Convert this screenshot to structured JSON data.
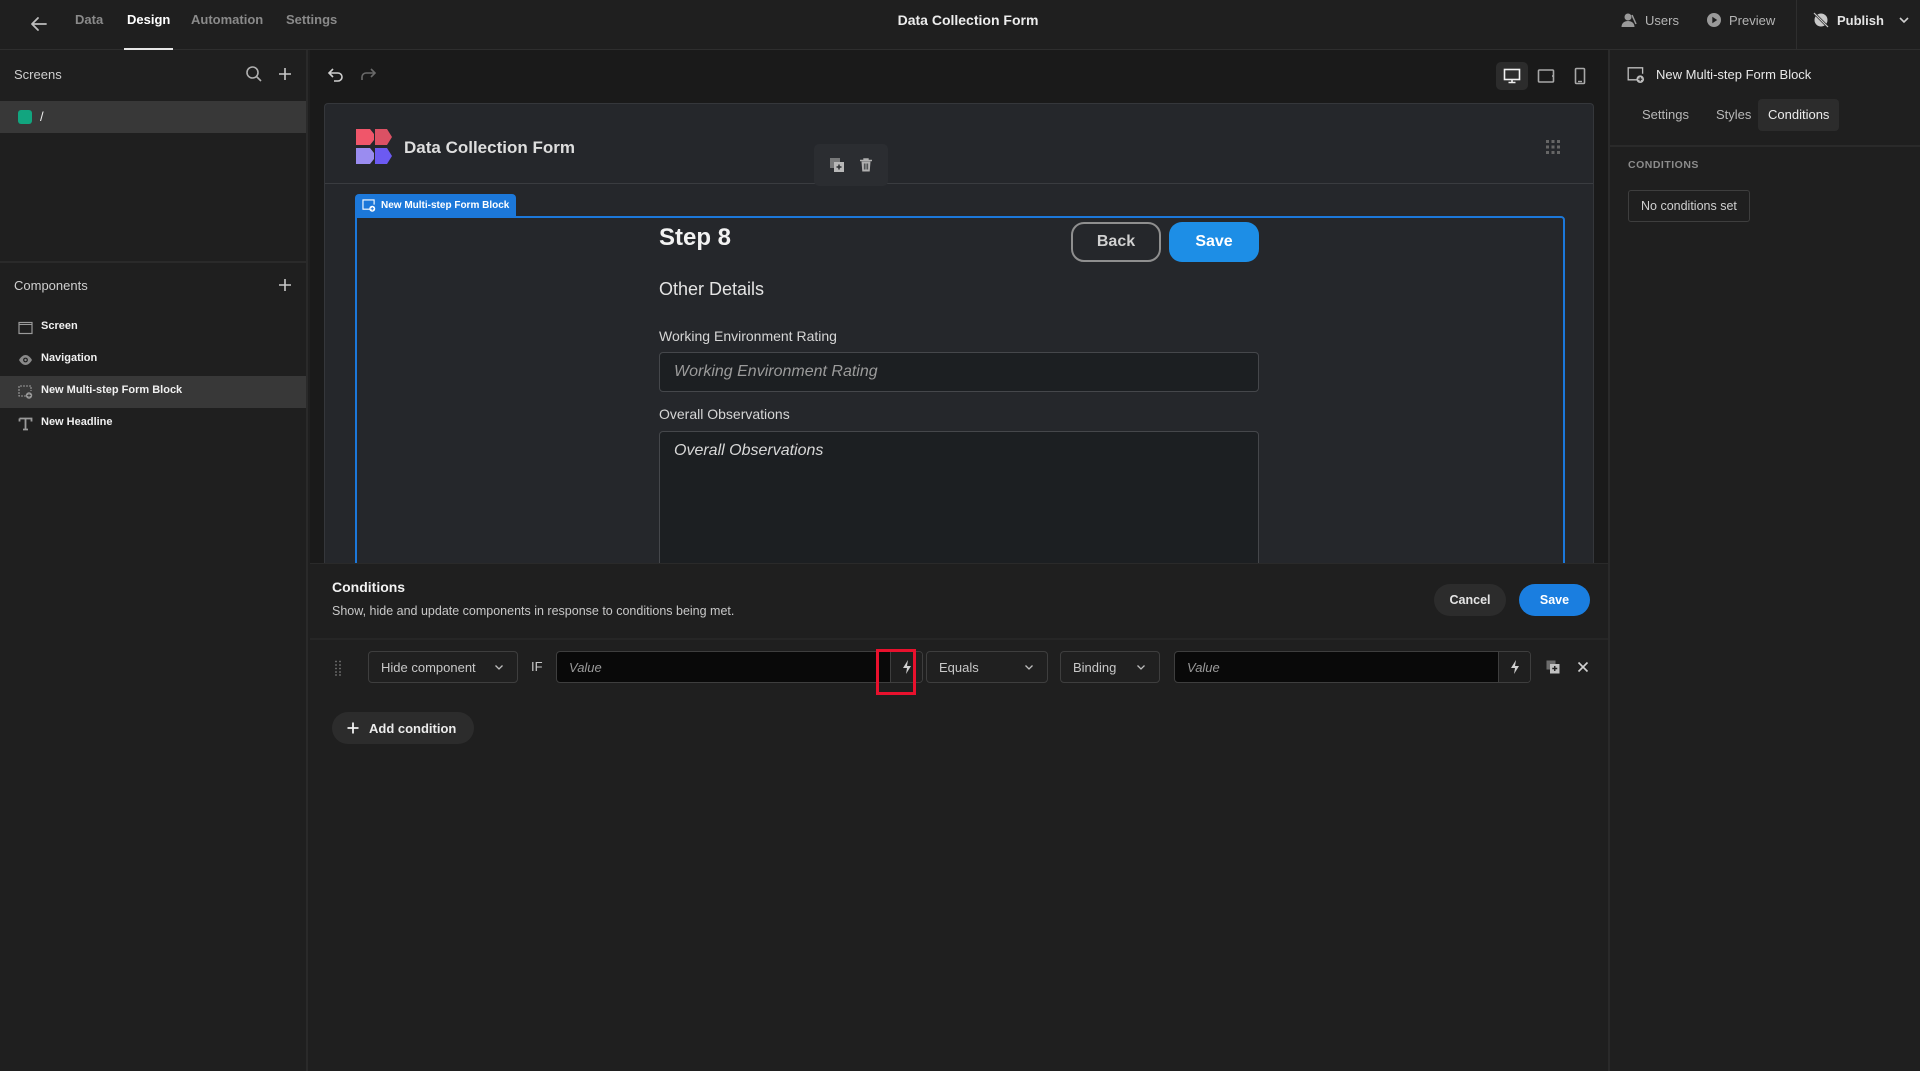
{
  "topbar": {
    "back_icon": "arrow-left-icon",
    "tabs": [
      {
        "label": "Data",
        "active": false
      },
      {
        "label": "Design",
        "active": true
      },
      {
        "label": "Automation",
        "active": false
      },
      {
        "label": "Settings",
        "active": false
      }
    ],
    "app_title": "Data Collection Form",
    "users_label": "Users",
    "preview_label": "Preview",
    "publish_label": "Publish"
  },
  "sidebar": {
    "screens_header": "Screens",
    "screens": [
      {
        "label": "/",
        "color": "#12a57f",
        "selected": true
      }
    ],
    "components_header": "Components",
    "components": [
      {
        "label": "Screen",
        "icon": "screen-icon",
        "selected": false
      },
      {
        "label": "Navigation",
        "icon": "eye-icon",
        "selected": false
      },
      {
        "label": "New Multi-step Form Block",
        "icon": "form-block-icon",
        "selected": true
      },
      {
        "label": "New Headline",
        "icon": "text-icon",
        "selected": false
      }
    ]
  },
  "canvas": {
    "preview_title": "Data Collection Form",
    "block_tag": "New Multi-step Form Block",
    "step_title": "Step 8",
    "back_label": "Back",
    "save_label": "Save",
    "section_heading": "Other Details",
    "fields": [
      {
        "label": "Working Environment Rating",
        "placeholder": "Working Environment Rating",
        "type": "text"
      },
      {
        "label": "Overall Observations",
        "placeholder": "Overall Observations",
        "type": "textarea"
      }
    ],
    "accent_color": "#1c78da"
  },
  "conditions_drawer": {
    "title": "Conditions",
    "subtitle": "Show, hide and update components in response to conditions being met.",
    "cancel_label": "Cancel",
    "save_label": "Save",
    "rows": [
      {
        "action": "Hide component",
        "if_label": "IF",
        "left_value_placeholder": "Value",
        "operator": "Equals",
        "type": "Binding",
        "right_value_placeholder": "Value"
      }
    ],
    "add_condition_label": "Add condition"
  },
  "right_panel": {
    "component_name": "New Multi-step Form Block",
    "tabs": [
      {
        "label": "Settings",
        "active": false
      },
      {
        "label": "Styles",
        "active": false
      },
      {
        "label": "Conditions",
        "active": true
      }
    ],
    "section_label": "CONDITIONS",
    "empty_state": "No conditions set"
  }
}
